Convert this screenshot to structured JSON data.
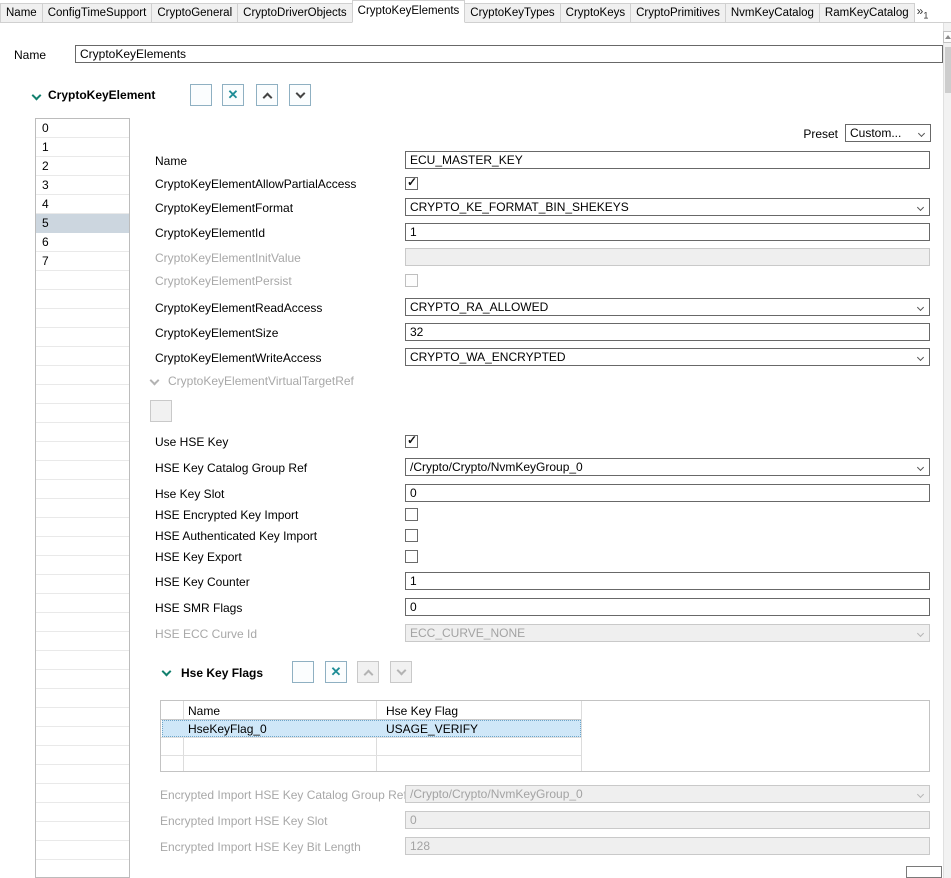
{
  "tab_bar": {
    "tabs": [
      "Name",
      "ConfigTimeSupport",
      "CryptoGeneral",
      "CryptoDriverObjects",
      "CryptoKeyElements",
      "CryptoKeyTypes",
      "CryptoKeys",
      "CryptoPrimitives",
      "NvmKeyCatalog",
      "RamKeyCatalog"
    ],
    "active_tab": "CryptoKeyElements",
    "overflow_glyph": "»",
    "overflow_count": "1"
  },
  "name_row": {
    "label": "Name",
    "value": "CryptoKeyElements"
  },
  "key_element_section": {
    "title": "CryptoKeyElement",
    "list": {
      "items": [
        "0",
        "1",
        "2",
        "3",
        "4",
        "5",
        "6",
        "7"
      ],
      "selected": "5"
    },
    "preset": {
      "label": "Preset",
      "value": "Custom..."
    },
    "fields": {
      "name": {
        "label": "Name",
        "value": "ECU_MASTER_KEY"
      },
      "allow_partial_access": {
        "label": "CryptoKeyElementAllowPartialAccess",
        "checked": true
      },
      "format": {
        "label": "CryptoKeyElementFormat",
        "value": "CRYPTO_KE_FORMAT_BIN_SHEKEYS"
      },
      "id": {
        "label": "CryptoKeyElementId",
        "value": "1"
      },
      "init_value": {
        "label": "CryptoKeyElementInitValue",
        "value": "",
        "disabled": true
      },
      "persist": {
        "label": "CryptoKeyElementPersist",
        "checked": false,
        "disabled": true
      },
      "read_access": {
        "label": "CryptoKeyElementReadAccess",
        "value": "CRYPTO_RA_ALLOWED"
      },
      "size": {
        "label": "CryptoKeyElementSize",
        "value": "32"
      },
      "write_access": {
        "label": "CryptoKeyElementWriteAccess",
        "value": "CRYPTO_WA_ENCRYPTED"
      },
      "virtual_target_ref": {
        "label": "CryptoKeyElementVirtualTargetRef",
        "disabled": true
      }
    },
    "hse_fields": {
      "use_hse_key": {
        "label": "Use HSE Key",
        "checked": true
      },
      "catalog_group_ref": {
        "label": "HSE Key Catalog Group Ref",
        "value": "/Crypto/Crypto/NvmKeyGroup_0"
      },
      "key_slot": {
        "label": "Hse Key Slot",
        "value": "0"
      },
      "encrypted_key_import": {
        "label": "HSE Encrypted Key Import",
        "checked": false
      },
      "authenticated_key_import": {
        "label": "HSE Authenticated Key Import",
        "checked": false
      },
      "key_export": {
        "label": "HSE Key Export",
        "checked": false
      },
      "key_counter": {
        "label": "HSE Key Counter",
        "value": "1"
      },
      "smr_flags": {
        "label": "HSE SMR Flags",
        "value": "0"
      },
      "ecc_curve_id": {
        "label": "HSE ECC Curve Id",
        "value": "ECC_CURVE_NONE",
        "disabled": true
      }
    },
    "hse_key_flags": {
      "title": "Hse Key Flags",
      "columns": {
        "name": "Name",
        "flag": "Hse Key Flag"
      },
      "rows": [
        {
          "name": "HseKeyFlag_0",
          "flag": "USAGE_VERIFY",
          "selected": true
        }
      ]
    },
    "encrypted_import": {
      "catalog_group_ref": {
        "label": "Encrypted Import HSE Key Catalog Group Ref",
        "value": "/Crypto/Crypto/NvmKeyGroup_0",
        "disabled": true
      },
      "key_slot": {
        "label": "Encrypted Import HSE Key Slot",
        "value": "0",
        "disabled": true
      },
      "bit_length": {
        "label": "Encrypted Import HSE Key Bit Length",
        "value": "128",
        "disabled": true
      }
    }
  },
  "colors": {
    "accent_teal": "#12806e",
    "plus_green": "#2f9e2f",
    "delete_teal": "#1d8c96",
    "list_selection": "#ccd6df",
    "table_selection": "#cfe7f8"
  }
}
